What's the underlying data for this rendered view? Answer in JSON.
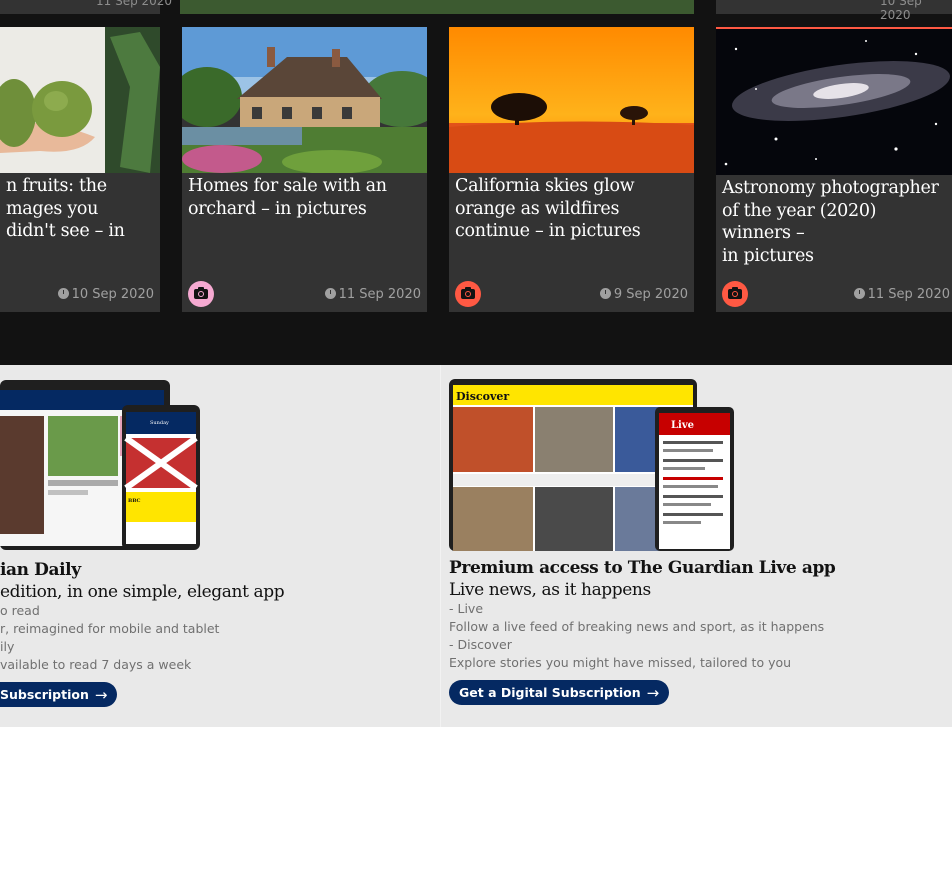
{
  "previous_row": {
    "dates": [
      "11 Sep 2020",
      "10 Sep 2020"
    ]
  },
  "cards": [
    {
      "headline_lines": [
        "n fruits: the",
        "mages you",
        "didn't see – in"
      ],
      "date": "10 Sep 2020",
      "icon": "camera-icon"
    },
    {
      "headline_lines": [
        "Homes for sale with an",
        "orchard – in pictures"
      ],
      "date": "11 Sep 2020",
      "icon": "camera-icon",
      "icon_color": "#f5a9d1"
    },
    {
      "headline_lines": [
        "California skies glow",
        "orange as wildfires",
        "continue – in pictures"
      ],
      "date": "9 Sep 2020",
      "icon": "camera-icon",
      "icon_color": "#ff5943"
    },
    {
      "headline_lines": [
        "Astronomy photographer",
        "of the year (2020) winners –",
        "in pictures"
      ],
      "date": "11 Sep 2020",
      "icon": "camera-icon",
      "icon_color": "#ff5943"
    }
  ],
  "promos": [
    {
      "title": "ian Daily",
      "subtitle": "edition, in one simple, elegant app",
      "lines": [
        "o read",
        "r, reimagined for mobile and tablet",
        "ily",
        "vailable to read 7 days a week"
      ],
      "button_label": " Subscription",
      "tablet_masthead": "Sunday",
      "phone_headline": "BBC"
    },
    {
      "title": "Premium access to The Guardian Live app",
      "subtitle": "Live news, as it happens",
      "lines": [
        "- Live",
        "Follow a live feed of breaking news and sport, as it happens",
        "- Discover",
        "Explore stories you might have missed, tailored to you"
      ],
      "button_label": "Get a Digital Subscription",
      "tablet_label": "Discover",
      "phone_label": "Live"
    }
  ],
  "colors": {
    "dark_bg": "#121212",
    "card_bg": "#333333",
    "promo_bg": "#e9e9e9",
    "button_bg": "#052962",
    "discover_yellow": "#ffe500",
    "live_red": "#c70000"
  }
}
